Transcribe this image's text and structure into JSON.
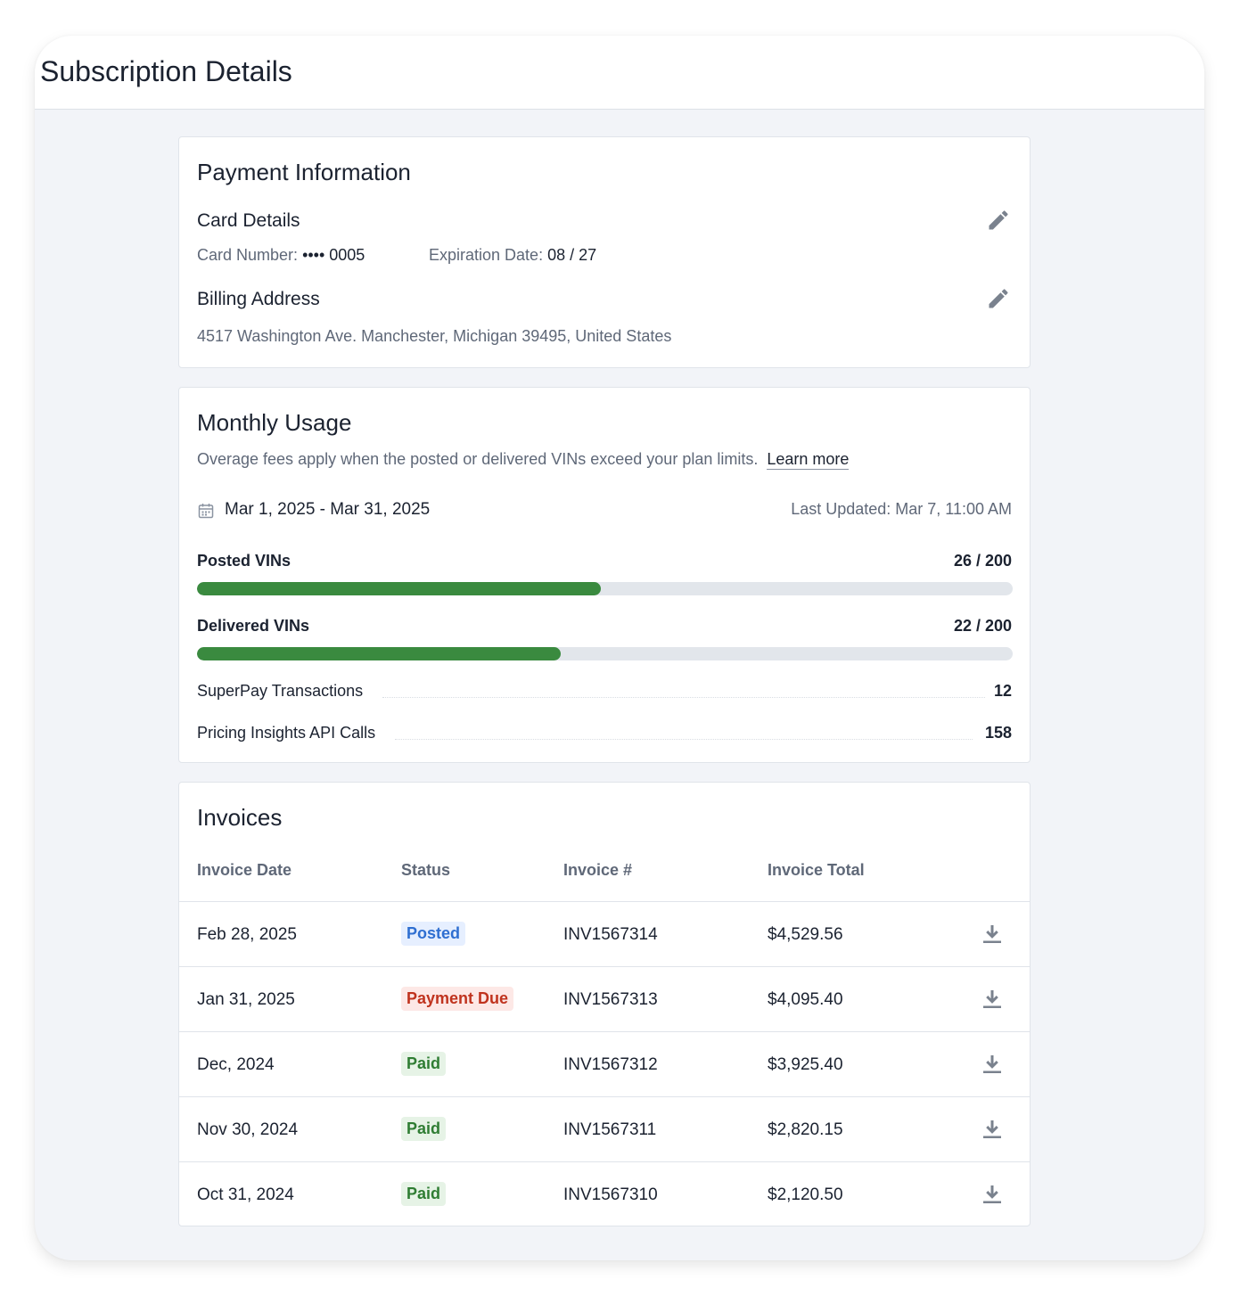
{
  "page": {
    "title": "Subscription Details"
  },
  "payment": {
    "title": "Payment Information",
    "card_details_label": "Card Details",
    "card_number_label": "Card Number:",
    "card_number_value": "•••• 0005",
    "expiration_label": "Expiration Date:",
    "expiration_value": "08 / 27",
    "billing_label": "Billing Address",
    "billing_address": "4517 Washington Ave. Manchester, Michigan 39495, United States",
    "edit_icon": "pencil-icon"
  },
  "usage": {
    "title": "Monthly Usage",
    "description": "Overage fees apply when the posted or delivered VINs exceed your plan limits.",
    "learn_more": "Learn more",
    "date_range": "Mar 1, 2025 - Mar 31, 2025",
    "last_updated": "Last Updated: Mar 7, 11:00 AM",
    "posted": {
      "label": "Posted VINs",
      "value": "26 / 200",
      "fill_fraction": 0.495
    },
    "delivered": {
      "label": "Delivered VINs",
      "value": "22 / 200",
      "fill_fraction": 0.446
    },
    "superpay": {
      "label": "SuperPay Transactions",
      "value": "12"
    },
    "pricing": {
      "label": "Pricing Insights API Calls",
      "value": "158"
    },
    "progress_color": "#3a8a3f"
  },
  "invoices": {
    "title": "Invoices",
    "headers": [
      "Invoice Date",
      "Status",
      "Invoice #",
      "Invoice Total"
    ],
    "rows": [
      {
        "date": "Feb 28, 2025",
        "status": "Posted",
        "status_kind": "blue",
        "number": "INV1567314",
        "total": "$4,529.56"
      },
      {
        "date": "Jan 31, 2025",
        "status": "Payment Due",
        "status_kind": "red",
        "number": "INV1567313",
        "total": "$4,095.40"
      },
      {
        "date": "Dec, 2024",
        "status": "Paid",
        "status_kind": "green",
        "number": "INV1567312",
        "total": "$3,925.40"
      },
      {
        "date": "Nov 30, 2024",
        "status": "Paid",
        "status_kind": "green",
        "number": "INV1567311",
        "total": "$2,820.15"
      },
      {
        "date": "Oct 31, 2024",
        "status": "Paid",
        "status_kind": "green",
        "number": "INV1567310",
        "total": "$2,120.50"
      }
    ],
    "download_icon": "download-icon"
  },
  "colors": {
    "background": "#f2f4f8",
    "posted_badge": "#2f6fd1",
    "due_badge": "#c0331e",
    "paid_badge": "#2f7d33"
  }
}
